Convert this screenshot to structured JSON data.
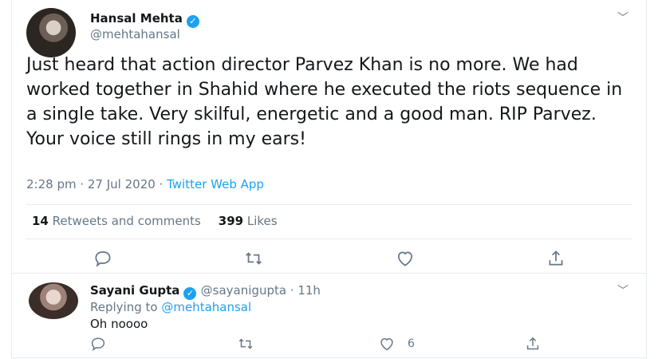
{
  "main_tweet": {
    "author_name": "Hansal Mehta",
    "author_handle": "@mehtahansal",
    "text": "Just heard that action director Parvez Khan is no more. We had worked together in Shahid where he executed the riots sequence in a single take. Very skilful, energetic and a good man. RIP Parvez. Your voice still rings in my ears!",
    "timestamp": "2:28 pm · 27 Jul 2020 · ",
    "source": "Twitter Web App",
    "retweets_count": "14",
    "retweets_label": "Retweets and comments",
    "likes_count": "399",
    "likes_label": "Likes"
  },
  "reply": {
    "author_name": "Sayani Gupta",
    "author_handle": "@sayanigupta · 11h",
    "replying_to_label": "Replying to ",
    "replying_to_handle": "@mehtahansal",
    "text": "Oh noooo",
    "like_count": "6"
  },
  "icons": {
    "verified": "verified-check-icon",
    "chevron": "chevron-down-icon",
    "reply": "reply-bubble-icon",
    "retweet": "retweet-icon",
    "like": "heart-icon",
    "share": "share-icon"
  },
  "colors": {
    "accent": "#1da1f2",
    "secondary_text": "#657786",
    "divider": "#e6ecf0"
  }
}
